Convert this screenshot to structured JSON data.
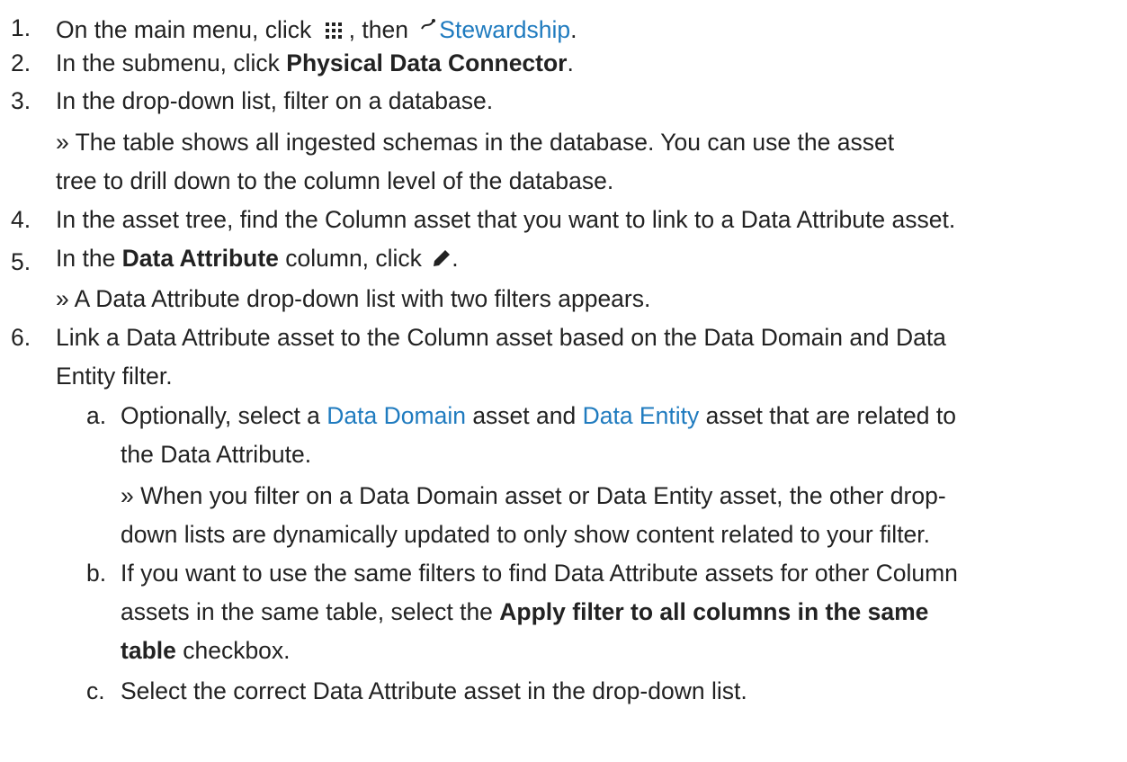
{
  "steps": {
    "s1": {
      "num": "1.",
      "pre": "On the main menu, click ",
      "mid": ", then ",
      "link": "Stewardship",
      "post": "."
    },
    "s2": {
      "num": "2.",
      "pre": "In the submenu, click ",
      "bold": "Physical Data Connector",
      "post": "."
    },
    "s3": {
      "num": "3.",
      "text": "In the drop-down list, filter on a database.",
      "result_l1": "» The table shows all ingested schemas in the database. You can use the asset",
      "result_l2": "tree to drill down to the column level of the database."
    },
    "s4": {
      "num": "4.",
      "text": "In the asset tree, find the Column asset that you want to link to a Data Attribute asset."
    },
    "s5": {
      "num": "5.",
      "pre": "In the ",
      "bold": "Data Attribute",
      "post": " column, click ",
      "end": ".",
      "result": "» A Data Attribute drop-down list with two filters appears."
    },
    "s6": {
      "num": "6.",
      "l1": "Link a Data Attribute asset to the Column asset based on the Data Domain and Data",
      "l2": "Entity filter."
    }
  },
  "substeps": {
    "a": {
      "num": "a.",
      "pre": "Optionally, select a ",
      "link1": "Data Domain",
      "mid": " asset and ",
      "link2": "Data Entity",
      "post": " asset that are related to",
      "l2": "the Data Attribute.",
      "result_l1": "» When you filter on a Data Domain asset or Data Entity asset, the other drop-",
      "result_l2": "down lists are dynamically updated to only show content related to your filter."
    },
    "b": {
      "num": "b.",
      "l1": "If you want to use the same filters to find Data Attribute assets for other Column",
      "l2_pre": "assets in the same table, select the ",
      "l2_bold": "Apply filter to all columns in the same",
      "l3_bold": "table",
      "l3_post": " checkbox."
    },
    "c": {
      "num": "c.",
      "text": "Select the correct Data Attribute asset in the drop-down list."
    }
  },
  "icons": {
    "menu": "grid-icon",
    "stewardship": "stewardship-icon",
    "edit": "pencil-icon"
  },
  "colors": {
    "link": "#1f7bbf",
    "text": "#222222"
  }
}
